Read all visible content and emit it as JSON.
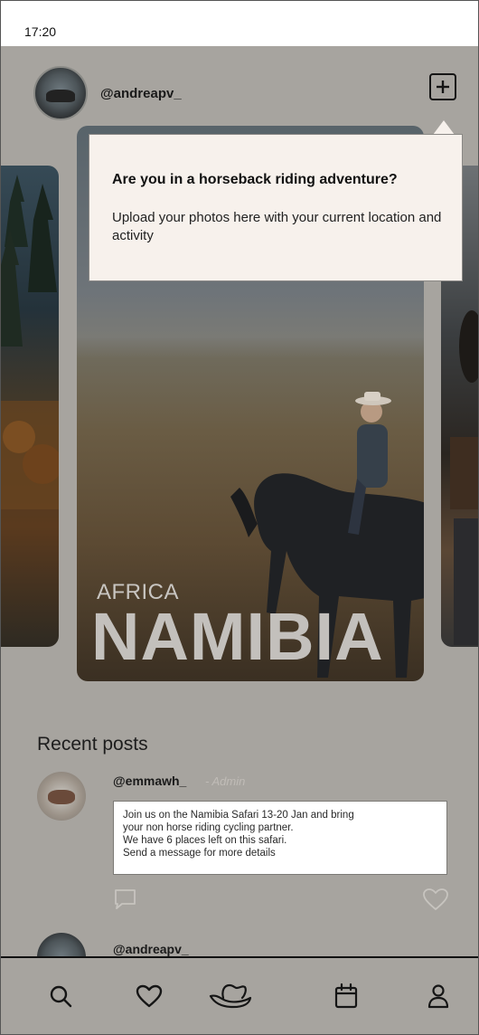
{
  "status_bar": {
    "time": "17:20"
  },
  "header": {
    "username": "@andreapv_",
    "icons": {
      "add": "plus-square-icon"
    }
  },
  "featured": {
    "region": "AFRICA",
    "country": "NAMIBIA"
  },
  "tooltip": {
    "title": "Are you in a horseback riding adventure?",
    "body": "Upload your photos here with your current location and activity"
  },
  "recent_posts": {
    "title": "Recent posts",
    "items": [
      {
        "username": "@emmawh_",
        "role": "- Admin",
        "text_lines": [
          "Join us on the Namibia Safari 13-20 Jan and bring",
          "your non horse riding cycling partner.",
          "We have 6 places left on this safari.",
          "Send a message for more details"
        ]
      },
      {
        "username": "@andreapv_"
      }
    ]
  },
  "tab_bar": {
    "icons": [
      "search-icon",
      "heart-icon",
      "riding-hat-icon",
      "calendar-icon",
      "profile-icon"
    ]
  },
  "colors": {
    "overlay_bg": "#a7a49f",
    "tooltip_bg": "#f7f1ec"
  }
}
